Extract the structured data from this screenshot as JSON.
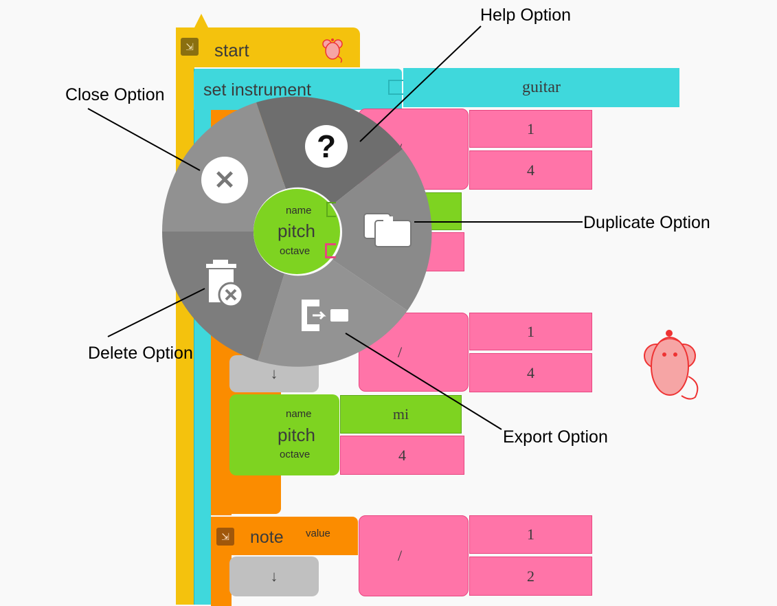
{
  "blocks": {
    "start_label": "start",
    "set_instrument_label": "set instrument",
    "instrument_value": "guitar",
    "divide_symbol": "/",
    "frac1": {
      "num": "1",
      "den": "4"
    },
    "frac2": {
      "num": "1",
      "den": "4"
    },
    "frac3": {
      "num": "1",
      "den": "2"
    },
    "pitch_label": "pitch",
    "name_label": "name",
    "octave_label": "octave",
    "pitch2": {
      "name": "mi",
      "octave": "4"
    },
    "note_label": "note",
    "value_label": "value",
    "down_arrow": "↓",
    "collapse_glyph": "⇲"
  },
  "menu": {
    "help_glyph": "?",
    "close_glyph": "✕",
    "center": {
      "pitch": "pitch",
      "name": "name",
      "octave": "octave"
    }
  },
  "annotations": {
    "help": "Help Option",
    "close": "Close Option",
    "duplicate": "Duplicate Option",
    "delete": "Delete Option",
    "export": "Export Option"
  },
  "colors": {
    "start": "#f4c20d",
    "instrument": "#3fd8dc",
    "note": "#fb8c00",
    "number": "#ff74a8",
    "pitch": "#7ed321",
    "menu": "#8c8c8c"
  }
}
